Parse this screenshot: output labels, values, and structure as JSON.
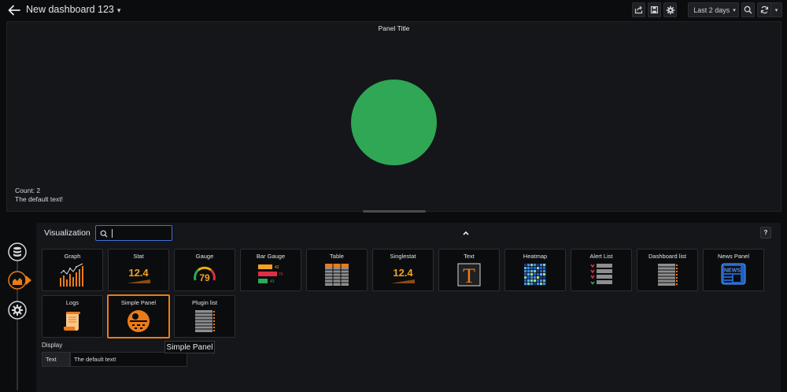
{
  "header": {
    "dashboard_title": "New dashboard 123",
    "time_range": "Last 2 days",
    "icons": [
      "back-arrow-icon",
      "share-icon",
      "save-icon",
      "settings-gear-icon",
      "clock-icon",
      "zoom-out-icon",
      "refresh-icon",
      "chevron-down-icon"
    ]
  },
  "panel": {
    "title": "Panel Title",
    "count_text": "Count: 2",
    "default_text": "The default text!",
    "circle_color": "#2fa755"
  },
  "editor": {
    "visualization_label": "Visualization",
    "search_value": "",
    "help_label": "?",
    "plugins": [
      {
        "label": "Graph",
        "icon": "graph-icon"
      },
      {
        "label": "Stat",
        "icon": "stat-icon"
      },
      {
        "label": "Gauge",
        "icon": "gauge-icon"
      },
      {
        "label": "Bar Gauge",
        "icon": "bar-gauge-icon"
      },
      {
        "label": "Table",
        "icon": "table-icon"
      },
      {
        "label": "Singlestat",
        "icon": "singlestat-icon"
      },
      {
        "label": "Text",
        "icon": "text-icon"
      },
      {
        "label": "Heatmap",
        "icon": "heatmap-icon"
      },
      {
        "label": "Alert List",
        "icon": "alert-list-icon"
      },
      {
        "label": "Dashboard list",
        "icon": "dashboard-list-icon"
      },
      {
        "label": "News Panel",
        "icon": "news-icon"
      },
      {
        "label": "Logs",
        "icon": "logs-icon"
      },
      {
        "label": "Simple Panel",
        "icon": "simple-panel-icon"
      },
      {
        "label": "Plugin list",
        "icon": "plugin-list-icon"
      }
    ],
    "stat_value": "12.4",
    "gauge_value": "79",
    "bar_gauge_values": [
      "42",
      "76",
      "43"
    ],
    "text_glyph": "T",
    "news_glyph": "NEWS",
    "selected_plugin": "Simple Panel",
    "display_section": "Display",
    "text_field_label": "Text",
    "text_field_value": "The default text!",
    "tooltip": "Simple Panel"
  },
  "colors": {
    "accent_orange": "#eb7b18",
    "selected_border": "#eb7b18",
    "focus_blue": "#3d71d9",
    "panel_bg": "#141619",
    "page_bg": "#0b0c0e"
  }
}
